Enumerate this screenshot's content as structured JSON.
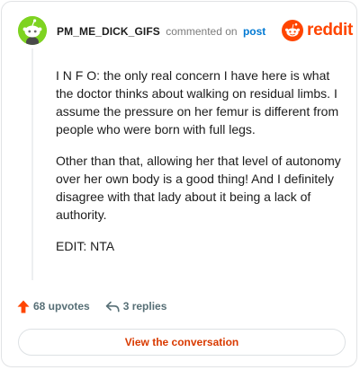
{
  "header": {
    "username": "PM_ME_DICK_GIFS",
    "commented_on": "commented on",
    "post_link": "post"
  },
  "brand": {
    "wordmark": "reddit",
    "color": "#ff4500"
  },
  "comment": {
    "paragraphs": [
      "I N F O: the only real concern I have here is what the doctor thinks about walking on residual limbs. I assume the pressure on her femur is different from people who were born with full legs.",
      "Other than that, allowing her that level of autonomy over her own body is a good thing! And I definitely disagree with that lady about it being a lack of authority.",
      "EDIT: NTA"
    ]
  },
  "actions": {
    "upvotes": "68 upvotes",
    "replies": "3 replies"
  },
  "cta": {
    "label": "View the conversation"
  },
  "colors": {
    "upvote": "#ff4500",
    "link": "#0079d3",
    "cta_text": "#d93a00",
    "avatar_bg": "#7ed321"
  },
  "icons": {
    "avatar": "snoo-avatar",
    "logo": "reddit-logo-icon",
    "upvote": "upvote-arrow-icon",
    "reply": "reply-arrow-icon"
  }
}
